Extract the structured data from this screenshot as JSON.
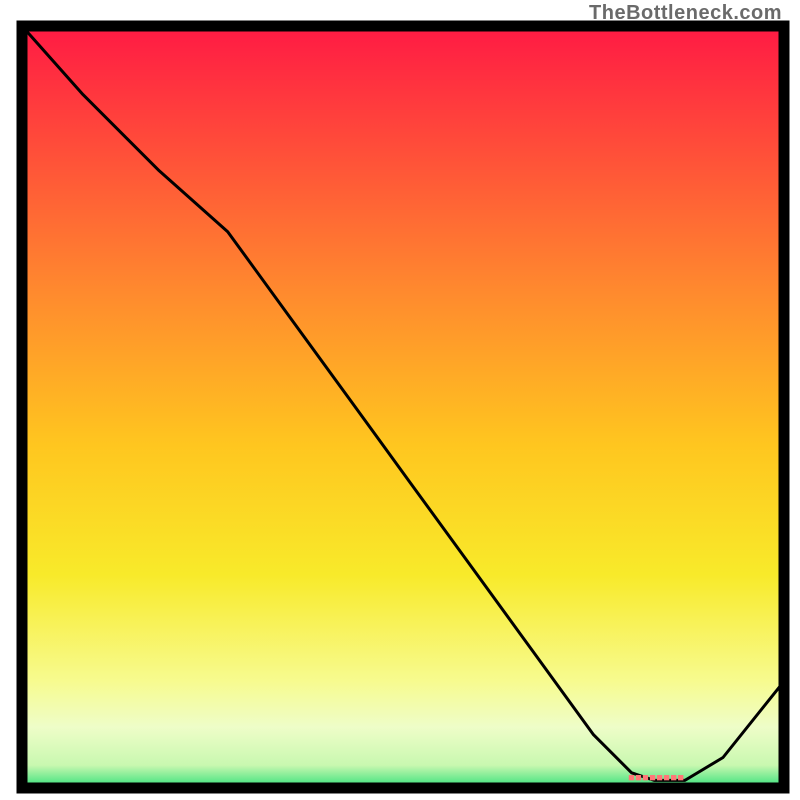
{
  "watermark": "TheBottleneck.com",
  "marker_label": "■■■■■■■■",
  "chart_data": {
    "type": "line",
    "title": "",
    "xlabel": "",
    "ylabel": "",
    "xlim": [
      0,
      100
    ],
    "ylim": [
      0,
      100
    ],
    "grid": false,
    "legend": false,
    "series": [
      {
        "name": "curve",
        "x": [
          0,
          8,
          18,
          27,
          35,
          43,
          51,
          59,
          67,
          75,
          80,
          83,
          87,
          92,
          100
        ],
        "y": [
          100,
          91,
          81,
          73,
          62,
          51,
          40,
          29,
          18,
          7,
          2,
          1,
          1,
          4,
          14
        ]
      }
    ],
    "marker_region": {
      "x0": 80,
      "x1": 88,
      "y": 1
    },
    "gradient_stops": [
      {
        "offset": 0.0,
        "color": "#ff1a44"
      },
      {
        "offset": 0.15,
        "color": "#ff4a3a"
      },
      {
        "offset": 0.35,
        "color": "#ff8a2e"
      },
      {
        "offset": 0.55,
        "color": "#ffc61f"
      },
      {
        "offset": 0.72,
        "color": "#f8ea2a"
      },
      {
        "offset": 0.86,
        "color": "#f7fb8f"
      },
      {
        "offset": 0.92,
        "color": "#eefdc8"
      },
      {
        "offset": 0.97,
        "color": "#c9f8b0"
      },
      {
        "offset": 1.0,
        "color": "#33e07a"
      }
    ]
  }
}
